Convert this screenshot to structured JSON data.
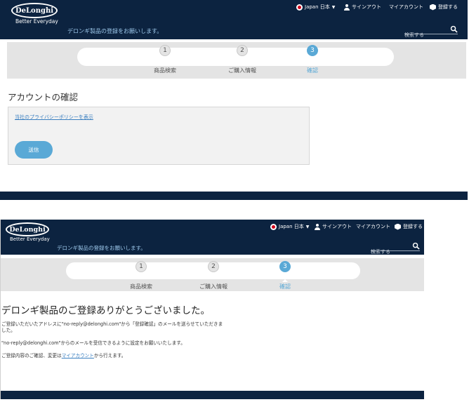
{
  "header": {
    "logo": "DeLonghi",
    "tagline": "Better Everyday",
    "welcome": "デロンギ製品の登録をお願いします。",
    "locale": "Japan 日本",
    "signout": "サインアウト",
    "my_account": "マイアカウント",
    "register": "登録する",
    "search_placeholder": "検索する"
  },
  "steps": [
    {
      "number": "1",
      "label": "商品検索",
      "active": false
    },
    {
      "number": "2",
      "label": "ご購入情報",
      "active": false
    },
    {
      "number": "3",
      "label": "確認",
      "active": true
    }
  ],
  "confirm": {
    "title": "アカウントの確認",
    "privacy_link": "当社のプライバシーポリシーを表示",
    "send_button": "送信"
  },
  "thanks": {
    "title": "デロンギ製品のご登録ありがとうございました。",
    "para1": "ご登録いただいたアドレスに\"no-reply@delonghi.com\"から「登録確認」のメールを送らせていただきました。",
    "para2": "\"no-reply@delonghi.com\"からのメールを受信できるように設定をお願いいたします。",
    "para3_prefix": "ご登録内容のご確認、変更は",
    "para3_link": "マイアカウント",
    "para3_suffix": "から行えます。"
  },
  "colors": {
    "navy": "#0c2340",
    "accent": "#5aa9d6",
    "link": "#3a7fc0"
  }
}
